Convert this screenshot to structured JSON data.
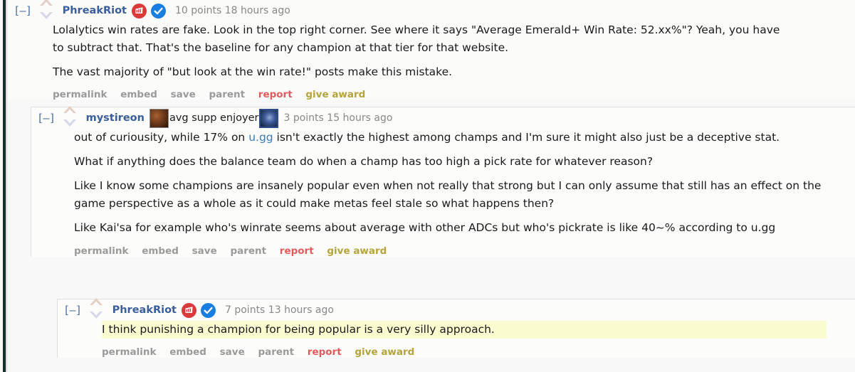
{
  "theme": {
    "username_color": "#3a5e9c",
    "link_color": "#3a7ac0",
    "meta_color": "#888888",
    "action_color": "#9a9a9a",
    "report_color": "#e05c5c",
    "award_color": "#b5a33c",
    "highlight_bg": "#fbfbd0",
    "page_bg": "#f8f8f8",
    "rail_color": "#16302c"
  },
  "actions": {
    "permalink": "permalink",
    "embed": "embed",
    "save": "save",
    "parent": "parent",
    "report": "report",
    "give_award": "give award"
  },
  "comments": [
    {
      "collapse": "[–]",
      "username": "PhreakRiot",
      "badges": [
        "riot-games-badge",
        "verified-badge"
      ],
      "meta": "10 points 18 hours ago",
      "paragraphs": [
        "Lolalytics win rates are fake. Look in the top right corner. See where it says \"Average Emerald+ Win Rate: 52.xx%\"? Yeah, you have to subtract that. That's the baseline for any champion at that tier for that website.",
        "The vast majority of \"but look at the win rate!\" posts make this mistake."
      ]
    },
    {
      "collapse": "[–]",
      "username": "mystireon",
      "flair_text": "avg supp enjoyer",
      "flair_icons": [
        "champion-flair-icon-left",
        "champion-flair-icon-right"
      ],
      "meta": "3 points 15 hours ago",
      "para1_before": "out of curiousity, while 17% on ",
      "para1_link": "u.gg",
      "para1_after": " isn't exactly the highest among champs and I'm sure it might also just be a deceptive stat.",
      "paragraphs": [
        "What if anything does the balance team do when a champ has too high a pick rate for whatever reason?",
        "Like I know some champions are insanely popular even when not really that strong but I can only assume that still has an effect on the game perspective as a whole as it could make metas feel stale so what happens then?",
        "Like Kai'sa for example who's winrate seems about average with other ADCs but who's pickrate is like 40~% according to u.gg"
      ]
    },
    {
      "collapse": "[–]",
      "username": "PhreakRiot",
      "badges": [
        "riot-games-badge",
        "verified-badge"
      ],
      "meta": "7 points 13 hours ago",
      "highlighted": true,
      "paragraphs": [
        "I think punishing a champion for being popular is a very silly approach."
      ]
    }
  ]
}
